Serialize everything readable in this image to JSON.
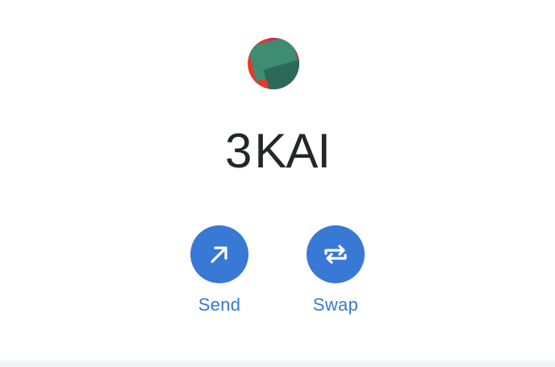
{
  "token": {
    "icon": "token-identicon",
    "balance": "3",
    "symbol": "KAI"
  },
  "actions": [
    {
      "label": "Send",
      "icon": "arrow-up-right-icon"
    },
    {
      "label": "Swap",
      "icon": "swap-arrows-icon"
    }
  ],
  "colors": {
    "accent": "#3779d4",
    "text": "#24272a",
    "identicon": [
      "#e6392d",
      "#3e8c72",
      "#2d6957",
      "#c42a6a"
    ]
  }
}
